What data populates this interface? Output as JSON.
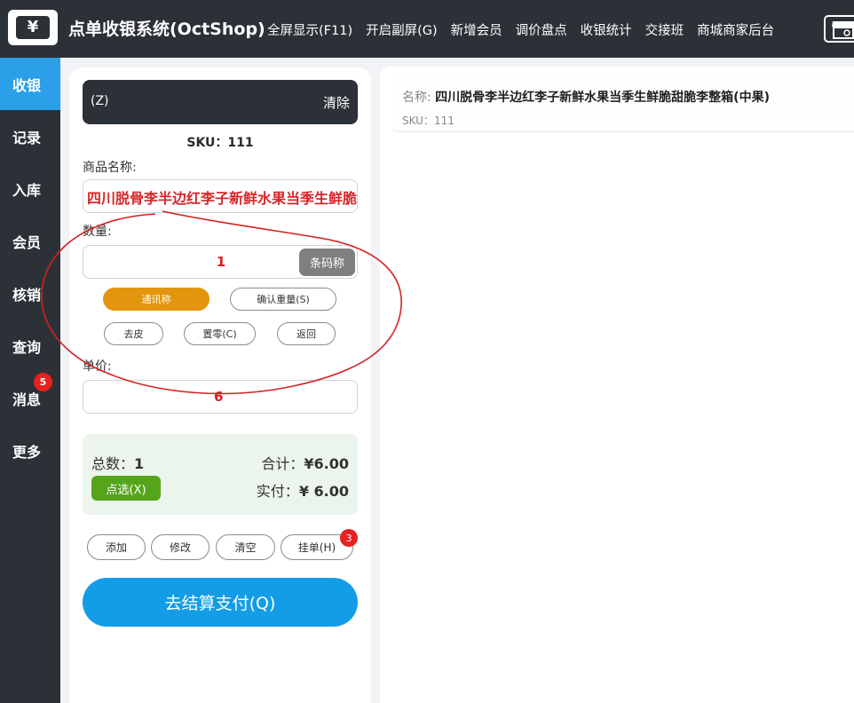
{
  "header": {
    "logo_symbol": "¥",
    "title": "点单收银系统(OctShop)",
    "nav": [
      "全屏显示(F11)",
      "开启副屏(G)",
      "新增会员",
      "调价盘点",
      "收银统计",
      "交接班",
      "商城商家后台"
    ],
    "store_icon": "store-icon"
  },
  "sidebar": {
    "items": [
      "收银",
      "记录",
      "入库",
      "会员",
      "核销",
      "查询",
      "消息",
      "更多"
    ],
    "active_index": 0,
    "message_badge": "5"
  },
  "scan": {
    "prefix": "(Z)",
    "clear_label": "清除"
  },
  "product": {
    "sku_line": "SKU：111",
    "name_label": "商品名称:",
    "name_value": "四川脱骨李半边红李子新鲜水果当季生鲜脆甜脆李整箱(中果)",
    "qty_label": "数量:",
    "qty_value": "1",
    "barcode_scale": "条码称",
    "price_label": "单价:",
    "price_value": "6"
  },
  "scale_buttons": {
    "comm_scale": "通讯称",
    "confirm_weight": "确认重量(S)",
    "tare": "去皮",
    "zero": "置零(C)",
    "back": "返回"
  },
  "summary": {
    "count_label": "总数：",
    "count_value": "1",
    "total_label": "合计：",
    "total_value": "¥6.00",
    "paid_label": "实付：",
    "paid_value": "¥ 6.00",
    "select_label": "点选(X)"
  },
  "actions": {
    "add": "添加",
    "edit": "修改",
    "clear": "清空",
    "hold": "挂单(H)",
    "hold_badge": "3",
    "checkout": "去结算支付(Q)"
  },
  "cart": {
    "name_label": "名称:",
    "name_value": "四川脱骨李半边红李子新鲜水果当季生鲜脆甜脆李整箱(中果)",
    "sku_text": "SKU：111"
  },
  "colors": {
    "dark": "#2c3138",
    "active_blue": "#2b9fe8",
    "checkout_blue": "#139de6",
    "orange": "#e3950d",
    "green": "#55a51c",
    "badge_red": "#e8201f",
    "annotation_red": "#d61f1f"
  }
}
